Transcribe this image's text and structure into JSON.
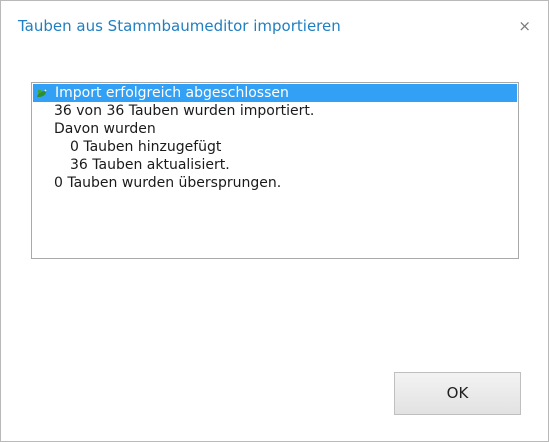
{
  "dialog": {
    "title": "Tauben aus Stammbaumeditor importieren",
    "close_glyph": "×"
  },
  "log": {
    "items": [
      {
        "icon": "pigeon-icon",
        "text": "Import erfolgreich abgeschlossen",
        "selected": true
      },
      {
        "text": "36 von 36 Tauben wurden importiert."
      },
      {
        "text": "Davon wurden"
      },
      {
        "text": "0 Tauben hinzugefügt"
      },
      {
        "text": "36 Tauben aktualisiert."
      },
      {
        "text": "0 Tauben wurden übersprungen."
      }
    ]
  },
  "buttons": {
    "ok_label": "OK"
  }
}
